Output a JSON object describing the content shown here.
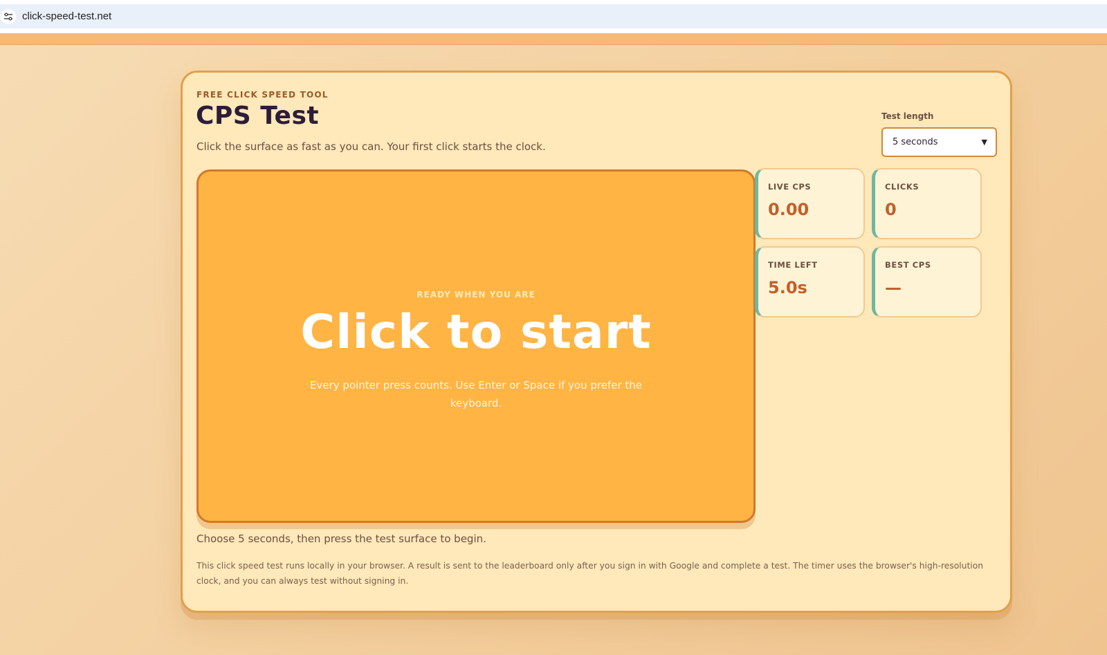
{
  "browser": {
    "url": "click-speed-test.net",
    "site_info_icon": "tune-icon"
  },
  "header": {
    "eyebrow": "FREE CLICK SPEED TOOL",
    "title": "CPS Test",
    "subtitle": "Click the surface as fast as you can. Your first click starts the clock."
  },
  "settings": {
    "length_label": "Test length",
    "selected_length": "5 seconds",
    "chevron_icon": "chevron-down-icon"
  },
  "surface": {
    "eyebrow": "READY WHEN YOU ARE",
    "title": "Click to start",
    "hint": "Every pointer press counts. Use Enter or Space if you prefer the keyboard."
  },
  "stats": {
    "live_cps": {
      "label": "LIVE CPS",
      "value": "0.00"
    },
    "clicks": {
      "label": "CLICKS",
      "value": "0"
    },
    "time_left": {
      "label": "TIME LEFT",
      "value": "5.0s"
    },
    "best_cps": {
      "label": "BEST CPS",
      "value": "—"
    }
  },
  "status_line": "Choose 5 seconds, then press the test surface to begin.",
  "footnote": "This click speed test runs locally in your browser. A result is sent to the leaderboard only after you sign in with Google and complete a test. The timer uses the browser's high-resolution clock, and you can always test without signing in.",
  "colors": {
    "accent": "#ffb444",
    "title": "#2c1d38",
    "stat_value": "#c0612d",
    "stat_border": "#6eb8a0",
    "card_bg": "#ffe8b9"
  }
}
